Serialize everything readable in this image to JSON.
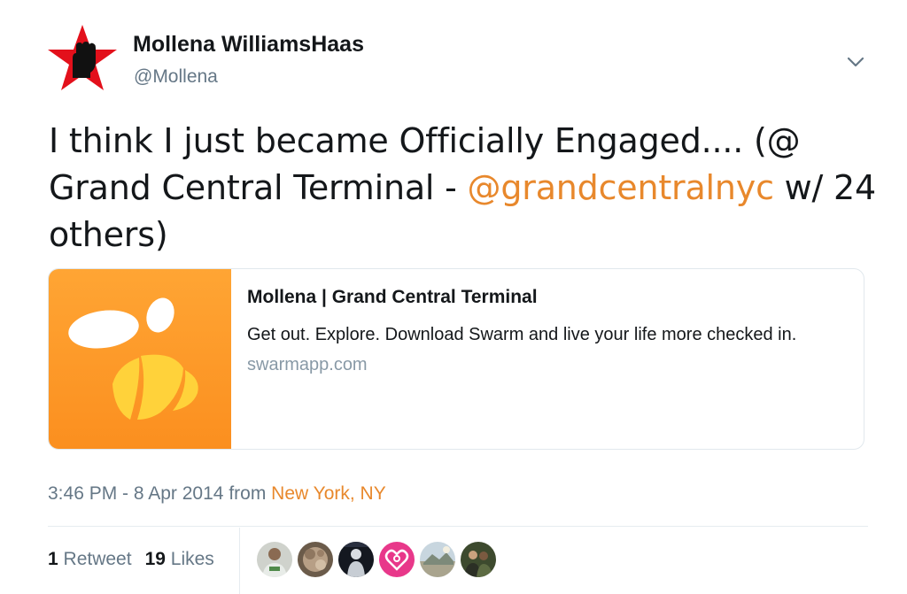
{
  "author": {
    "display_name": "Mollena WilliamsHaas",
    "handle": "@Mollena",
    "avatar_icon": "red-star-raised-fist-icon"
  },
  "tweet": {
    "text_part1": "I think I just became Officially Engaged.... (@ Grand Central Terminal - ",
    "mention": "@grandcentralnyc",
    "text_part2": " w/ 24 others)"
  },
  "card": {
    "title": "Mollena | Grand Central Terminal",
    "description": "Get out. Explore. Download Swarm and live your life more checked in.",
    "domain": "swarmapp.com",
    "image_icon": "swarm-bee-logo-icon"
  },
  "meta": {
    "time": "3:46 PM - 8 Apr 2014",
    "from_label": "from",
    "location": "New York, NY"
  },
  "stats": {
    "retweets_count": "1",
    "retweets_label": "Retweet",
    "likes_count": "19",
    "likes_label": "Likes"
  },
  "liker_avatars": [
    "liker-avatar-1",
    "liker-avatar-2",
    "liker-avatar-3",
    "liker-avatar-4",
    "liker-avatar-5",
    "liker-avatar-6"
  ],
  "colors": {
    "link": "#e8882c",
    "muted": "#657786",
    "text": "#14171a",
    "card_border": "#e1e8ed",
    "swarm_orange": "#fb8f1f"
  }
}
